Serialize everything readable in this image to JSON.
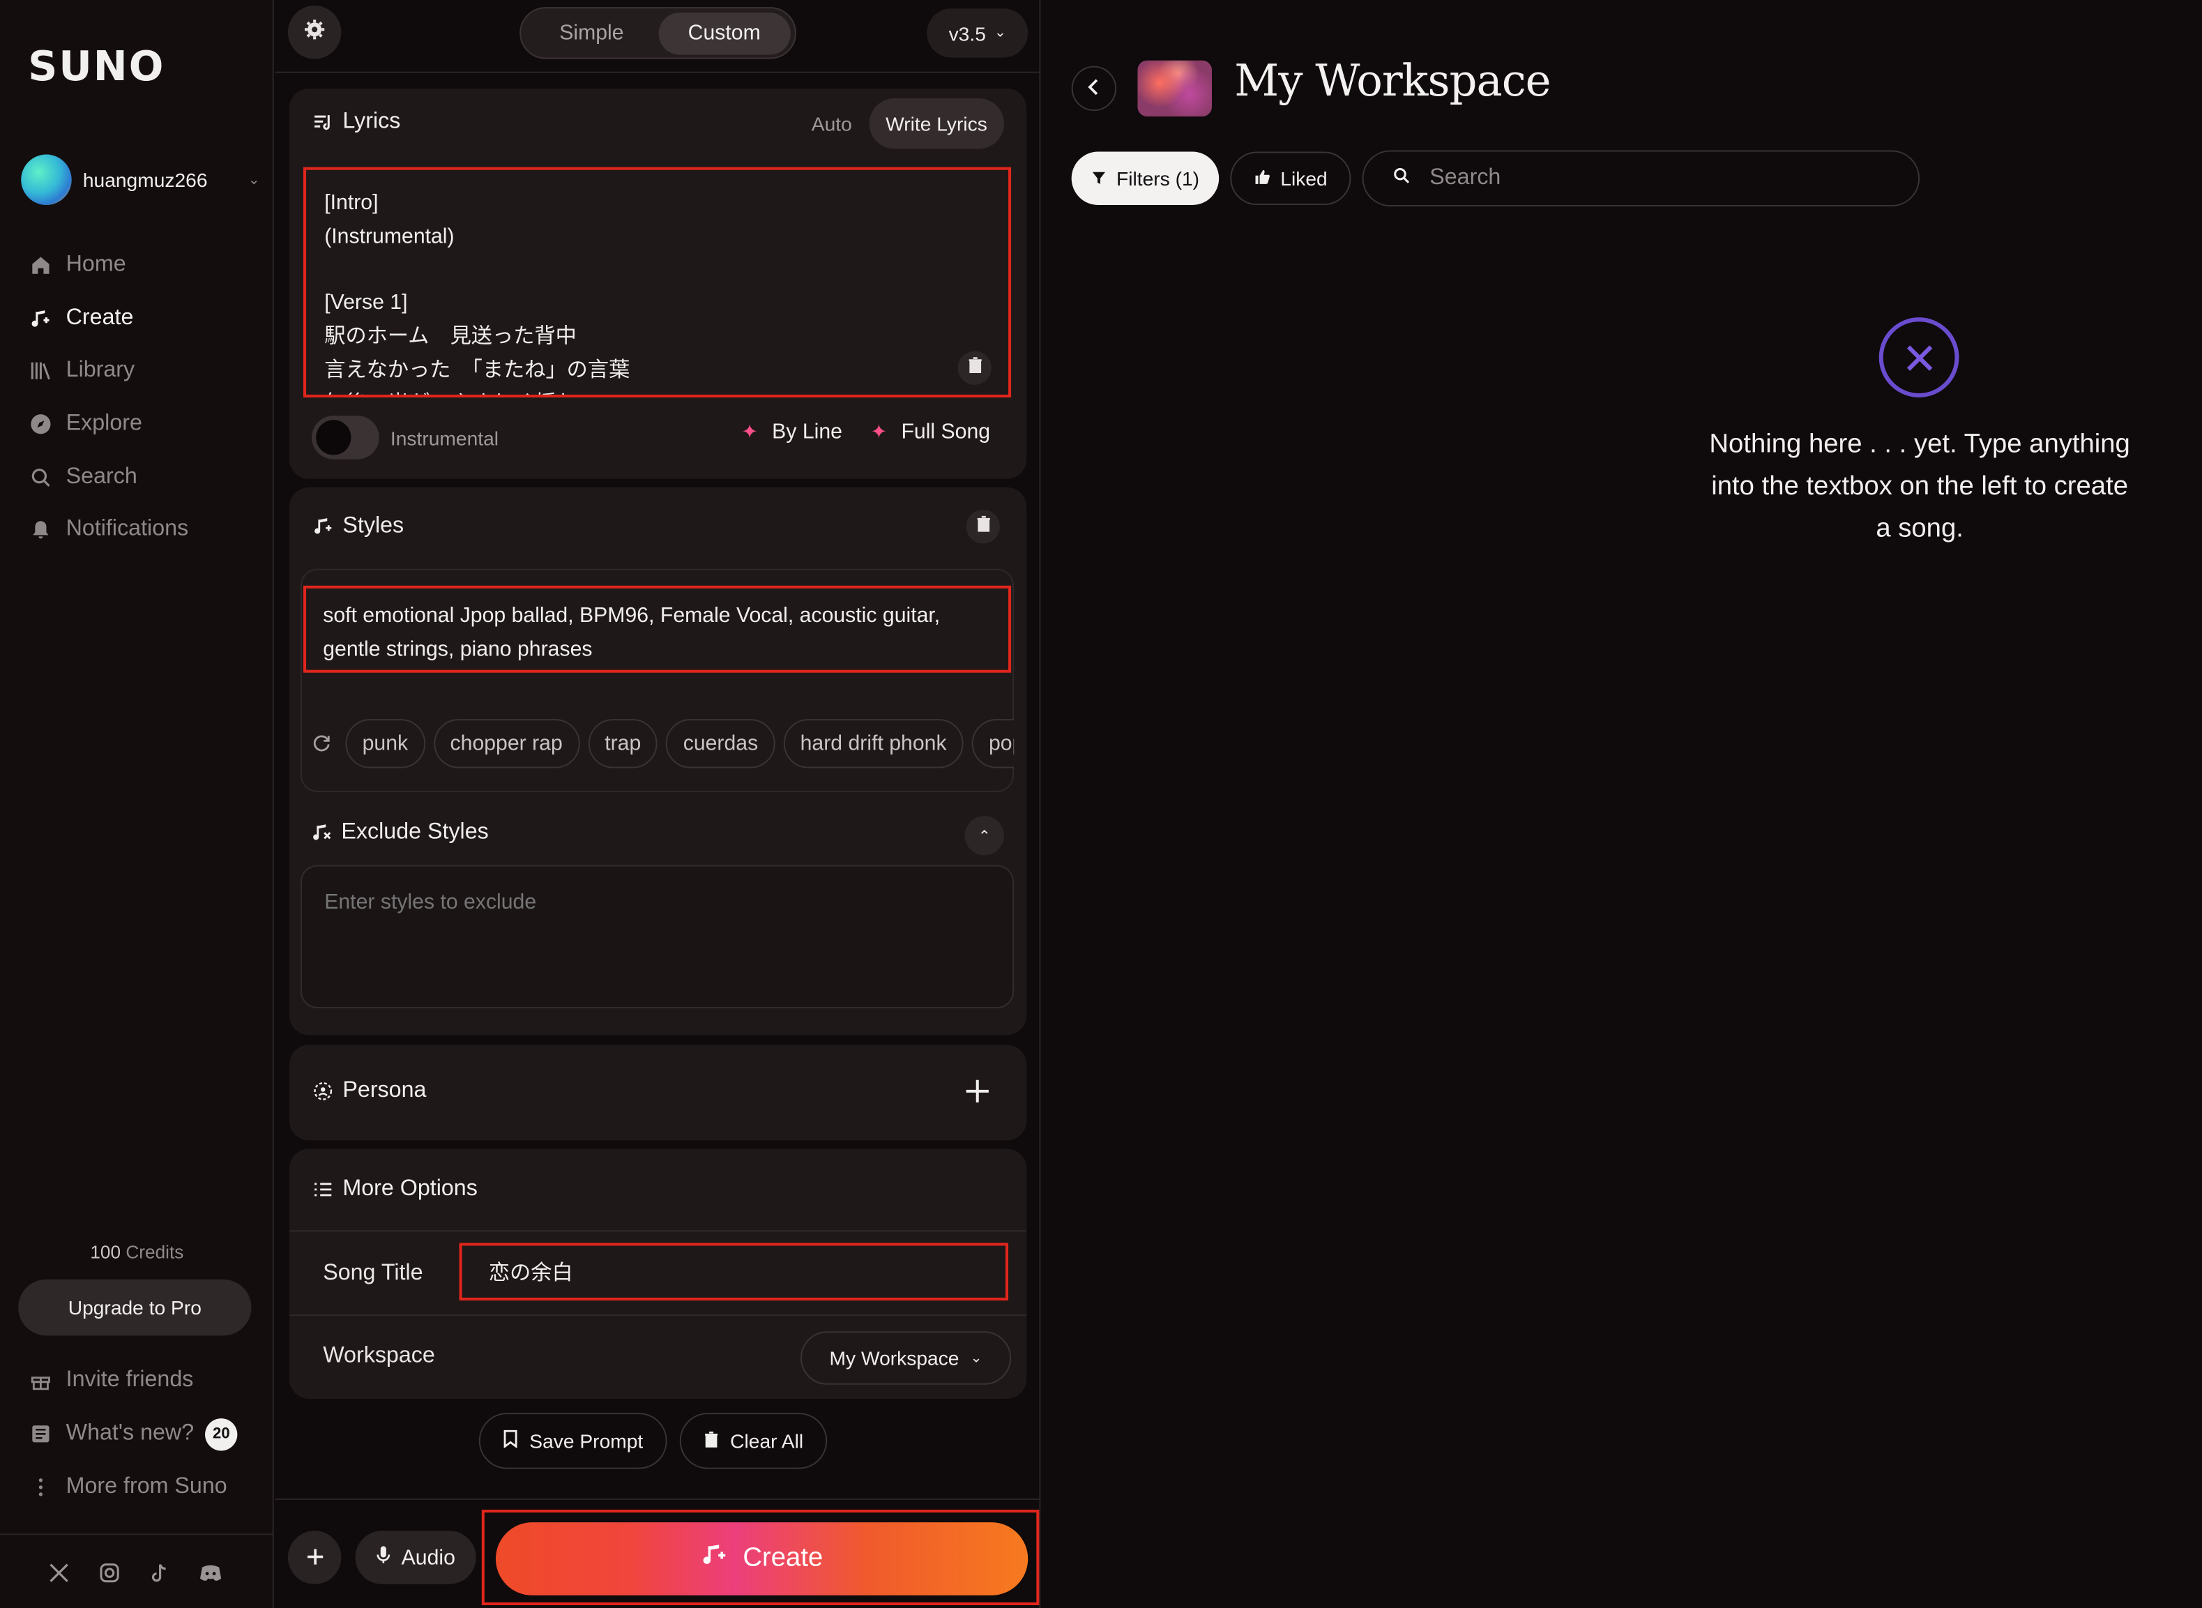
{
  "sidebar": {
    "logo": "SUNO",
    "username": "huangmuz266",
    "nav": [
      "Home",
      "Create",
      "Library",
      "Explore",
      "Search",
      "Notifications"
    ],
    "credits_value": "100",
    "credits_label": "Credits",
    "upgrade_label": "Upgrade to Pro",
    "footer": {
      "invite": "Invite friends",
      "whats_new": "What's new?",
      "whats_new_count": "20",
      "more": "More from Suno"
    },
    "socials": [
      "x-icon",
      "instagram-icon",
      "tiktok-icon",
      "discord-icon"
    ]
  },
  "create": {
    "mode": {
      "simple": "Simple",
      "custom": "Custom"
    },
    "version": "v3.5",
    "lyrics": {
      "title": "Lyrics",
      "tab_auto": "Auto",
      "tab_write": "Write Lyrics",
      "text": "[Intro]\n(Instrumental)\n\n[Verse 1]\n駅のホーム　見送った背中\n言えなかった　「またね」の言葉\n午後の光が　やさしく揺れて",
      "instrumental_label": "Instrumental",
      "by_line": "By Line",
      "full_song": "Full Song"
    },
    "styles": {
      "title": "Styles",
      "text": "soft emotional Jpop ballad, BPM96, Female Vocal, acoustic guitar, gentle strings, piano phrases",
      "chips": [
        "punk",
        "chopper rap",
        "trap",
        "cuerdas",
        "hard drift phonk",
        "pop"
      ]
    },
    "exclude": {
      "title": "Exclude Styles",
      "placeholder": "Enter styles to exclude"
    },
    "persona": {
      "title": "Persona"
    },
    "more_options": {
      "title": "More Options",
      "song_title_label": "Song Title",
      "song_title_value": "恋の余白",
      "workspace_label": "Workspace",
      "workspace_value": "My Workspace"
    },
    "save_prompt": "Save Prompt",
    "clear_all": "Clear All",
    "audio": "Audio",
    "create_button": "Create"
  },
  "workspace": {
    "title": "My Workspace",
    "filters": "Filters (1)",
    "liked": "Liked",
    "search_placeholder": "Search",
    "empty_message": "Nothing here . . . yet. Type anything into the textbox on the left to create a song."
  },
  "colors": {
    "highlight": "#e0261c",
    "accent_pink": "#ff4f8a",
    "empty_icon": "#6a4ccf"
  }
}
